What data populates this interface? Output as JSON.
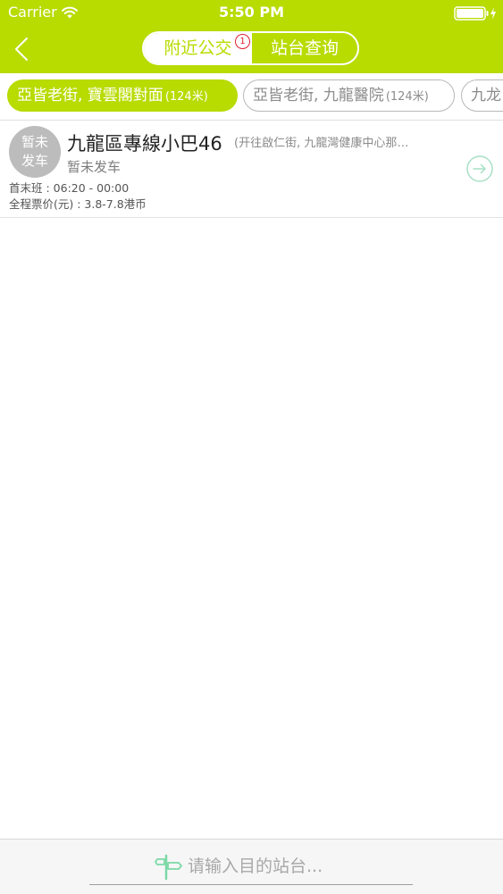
{
  "status_bar": {
    "carrier": "Carrier",
    "time": "5:50 PM"
  },
  "nav": {
    "tabs": [
      {
        "label": "附近公交",
        "active": true,
        "badge": "1"
      },
      {
        "label": "站台查询",
        "active": false
      }
    ]
  },
  "stops": [
    {
      "name": "亞皆老街, 寶雲閣對面",
      "distance": "(124米)",
      "selected": true
    },
    {
      "name": "亞皆老街, 九龍醫院",
      "distance": "(124米)",
      "selected": false
    },
    {
      "name": "九龙",
      "distance": "",
      "selected": false
    }
  ],
  "routes": [
    {
      "avatar_text": [
        "暂未",
        "发车"
      ],
      "name": "九龍區專線小巴46",
      "direction": "(开往啟仁街, 九龍灣健康中心那…",
      "status": "暂未发车",
      "hours": "首末班 : 06:20 - 00:00",
      "fare": "全程票价(元) : 3.8-7.8港币"
    }
  ],
  "bottom": {
    "placeholder": "请输入目的站台..."
  },
  "colors": {
    "brand": "#b8db00",
    "badge": "#e0202f"
  }
}
